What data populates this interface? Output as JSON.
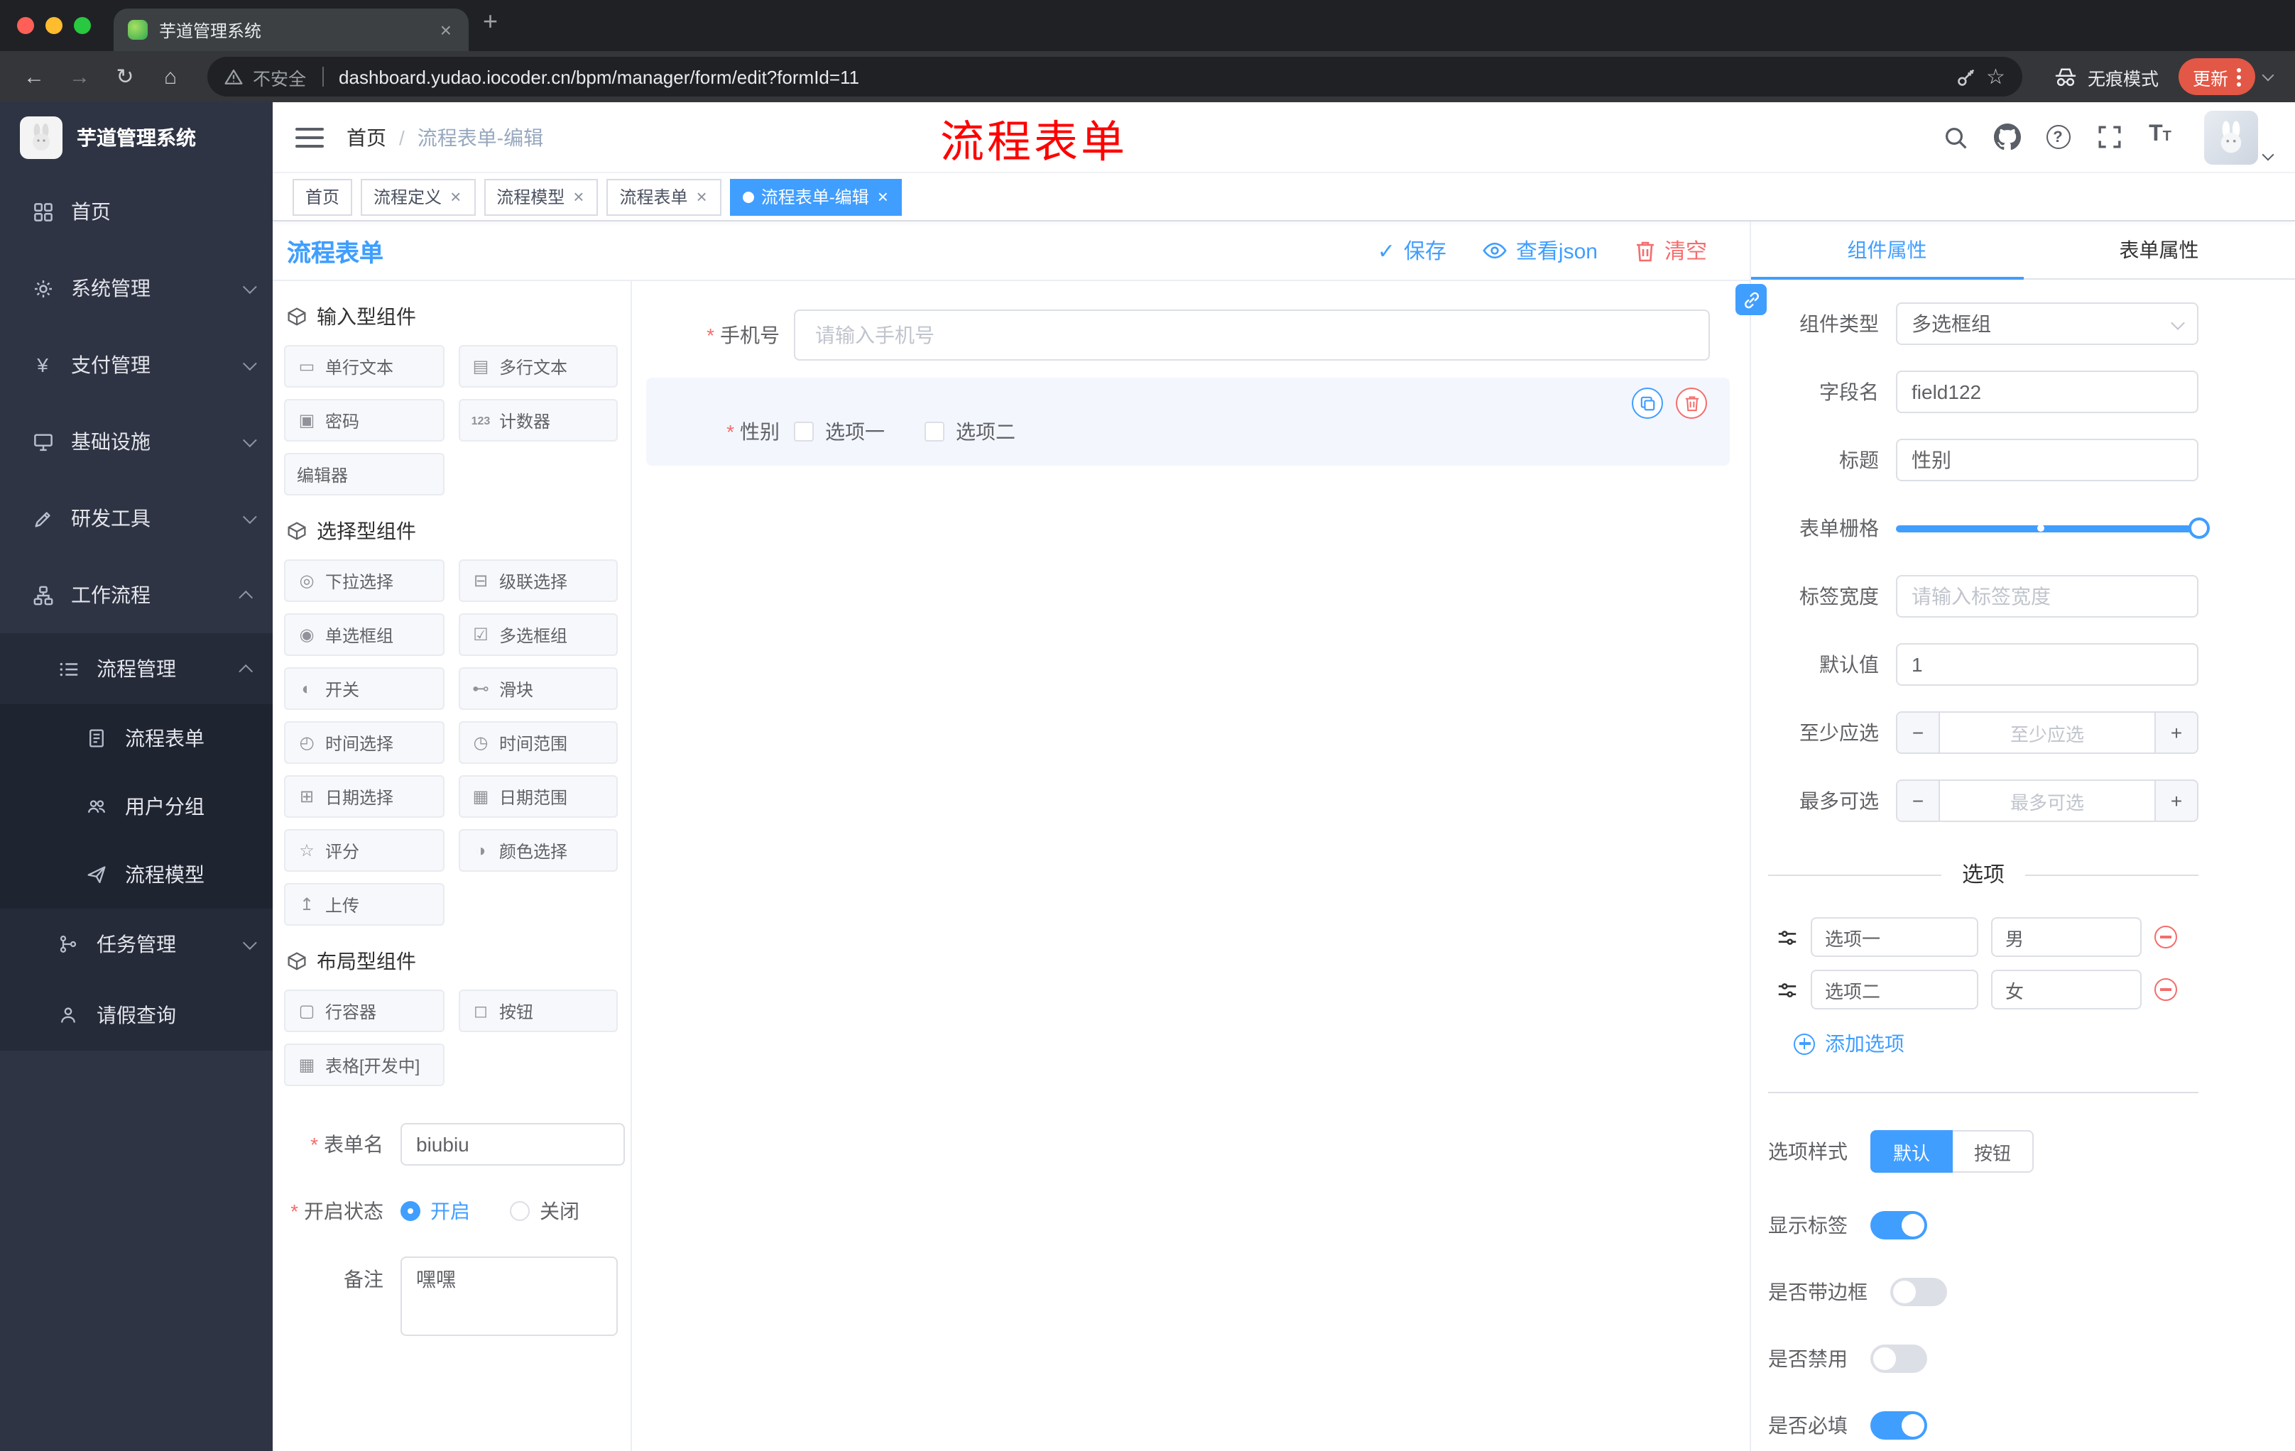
{
  "colors": {
    "accent": "#409eff",
    "danger": "#f56c6c",
    "sidebar_bg": "#2f3444",
    "annotation_red": "#ff0000",
    "update_pill": "#e25745",
    "active_tag": "#409eff"
  },
  "icons": {
    "close": "×",
    "new_tab": "+",
    "back": "←",
    "forward": "→",
    "reload": "↻",
    "home": "⌂",
    "star": "☆",
    "check": "✓",
    "yen": "¥"
  },
  "browser": {
    "tab_title": "芋道管理系统",
    "security_label": "不安全",
    "url": "dashboard.yudao.iocoder.cn/bpm/manager/form/edit?formId=11",
    "incognito_label": "无痕模式",
    "update_label": "更新"
  },
  "sidebar": {
    "logo_title": "芋道管理系统",
    "items": [
      {
        "label": "首页"
      },
      {
        "label": "系统管理"
      },
      {
        "label": "支付管理"
      },
      {
        "label": "基础设施"
      },
      {
        "label": "研发工具"
      },
      {
        "label": "工作流程"
      }
    ],
    "workflow": {
      "manage_label": "流程管理",
      "children": [
        {
          "label": "流程表单"
        },
        {
          "label": "用户分组"
        },
        {
          "label": "流程模型"
        }
      ],
      "task_label": "任务管理",
      "leave_label": "请假查询"
    }
  },
  "header": {
    "breadcrumb_home": "首页",
    "breadcrumb_sep": "/",
    "breadcrumb_current": "流程表单-编辑",
    "annotation": "流程表单"
  },
  "tags": [
    {
      "label": "首页"
    },
    {
      "label": "流程定义"
    },
    {
      "label": "流程模型"
    },
    {
      "label": "流程表单"
    },
    {
      "label": "流程表单-编辑"
    }
  ],
  "designer": {
    "title": "流程表单",
    "save_label": "保存",
    "view_json_label": "查看json",
    "clear_label": "清空"
  },
  "panel": {
    "groups": [
      {
        "title": "输入型组件",
        "items": [
          {
            "icon": "▭",
            "label": "单行文本"
          },
          {
            "icon": "▤",
            "label": "多行文本"
          },
          {
            "icon": "▣",
            "label": "密码"
          },
          {
            "icon": "123",
            "label": "计数器"
          },
          {
            "icon": "",
            "label": "编辑器"
          }
        ]
      },
      {
        "title": "选择型组件",
        "items": [
          {
            "icon": "◎",
            "label": "下拉选择"
          },
          {
            "icon": "⊟",
            "label": "级联选择"
          },
          {
            "icon": "◉",
            "label": "单选框组"
          },
          {
            "icon": "☑",
            "label": "多选框组"
          },
          {
            "icon": "◐",
            "label": "开关"
          },
          {
            "icon": "⊷",
            "label": "滑块"
          },
          {
            "icon": "◴",
            "label": "时间选择"
          },
          {
            "icon": "◷",
            "label": "时间范围"
          },
          {
            "icon": "⊞",
            "label": "日期选择"
          },
          {
            "icon": "▦",
            "label": "日期范围"
          },
          {
            "icon": "☆",
            "label": "评分"
          },
          {
            "icon": "◑",
            "label": "颜色选择"
          },
          {
            "icon": "↥",
            "label": "上传"
          }
        ]
      },
      {
        "title": "布局型组件",
        "items": [
          {
            "icon": "▢",
            "label": "行容器"
          },
          {
            "icon": "◻",
            "label": "按钮"
          },
          {
            "icon": "▦",
            "label": "表格[开发中]"
          }
        ]
      }
    ],
    "form": {
      "name_label": "表单名",
      "name_value": "biubiu",
      "status_label": "开启状态",
      "status_on": "开启",
      "status_off": "关闭",
      "remark_label": "备注",
      "remark_value": "嘿嘿"
    }
  },
  "canvas": {
    "phone_label": "手机号",
    "phone_placeholder": "请输入手机号",
    "gender_label": "性别",
    "gender_options": [
      {
        "label": "选项一"
      },
      {
        "label": "选项二"
      }
    ]
  },
  "props": {
    "tab_component": "组件属性",
    "tab_form": "表单属性",
    "type_label": "组件类型",
    "type_value": "多选框组",
    "field_label": "字段名",
    "field_value": "field122",
    "title_label": "标题",
    "title_value": "性别",
    "grid_label": "表单栅格",
    "tagwidth_label": "标签宽度",
    "tagwidth_placeholder": "请输入标签宽度",
    "default_label": "默认值",
    "default_value": "1",
    "min_label": "至少应选",
    "min_placeholder": "至少应选",
    "max_label": "最多可选",
    "max_placeholder": "最多可选",
    "options_title": "选项",
    "options": [
      {
        "label": "选项一",
        "value": "男"
      },
      {
        "label": "选项二",
        "value": "女"
      }
    ],
    "add_option_label": "添加选项",
    "style_label": "选项样式",
    "style_default": "默认",
    "style_button": "按钮",
    "switch_show_label": "显示标签",
    "switch_border_label": "是否带边框",
    "switch_disabled_label": "是否禁用",
    "switch_required_label": "是否必填"
  }
}
